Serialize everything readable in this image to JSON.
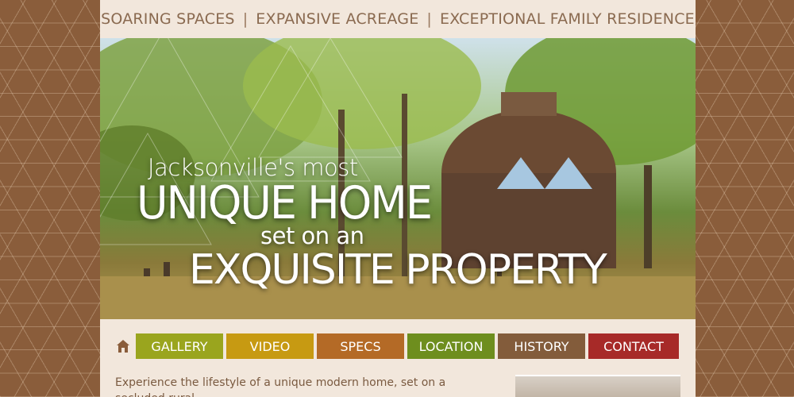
{
  "header": {
    "tagline_items": [
      "SOARING SPACES",
      "EXPANSIVE ACREAGE",
      "EXCEPTIONAL FAMILY RESIDENCE"
    ],
    "separator": "|"
  },
  "hero": {
    "line1": "Jacksonville's most",
    "line2": "UNIQUE HOME",
    "line3": "set on an",
    "line4": "EXQUISITE PROPERTY"
  },
  "nav": {
    "home_icon": "home-icon",
    "items": [
      {
        "label": "GALLERY",
        "color": "#9aa51e"
      },
      {
        "label": "VIDEO",
        "color": "#c79a12"
      },
      {
        "label": "SPECS",
        "color": "#b46a26"
      },
      {
        "label": "LOCATION",
        "color": "#6e8e1e"
      },
      {
        "label": "HISTORY",
        "color": "#835c3b"
      },
      {
        "label": "CONTACT",
        "color": "#a72a28"
      }
    ]
  },
  "intro": {
    "text": "Experience the lifestyle of a unique modern home, set on a secluded rural"
  },
  "colors": {
    "background": "#8a5d3b",
    "panel": "#f2e7dc",
    "tagline_text": "#8a6a50"
  }
}
